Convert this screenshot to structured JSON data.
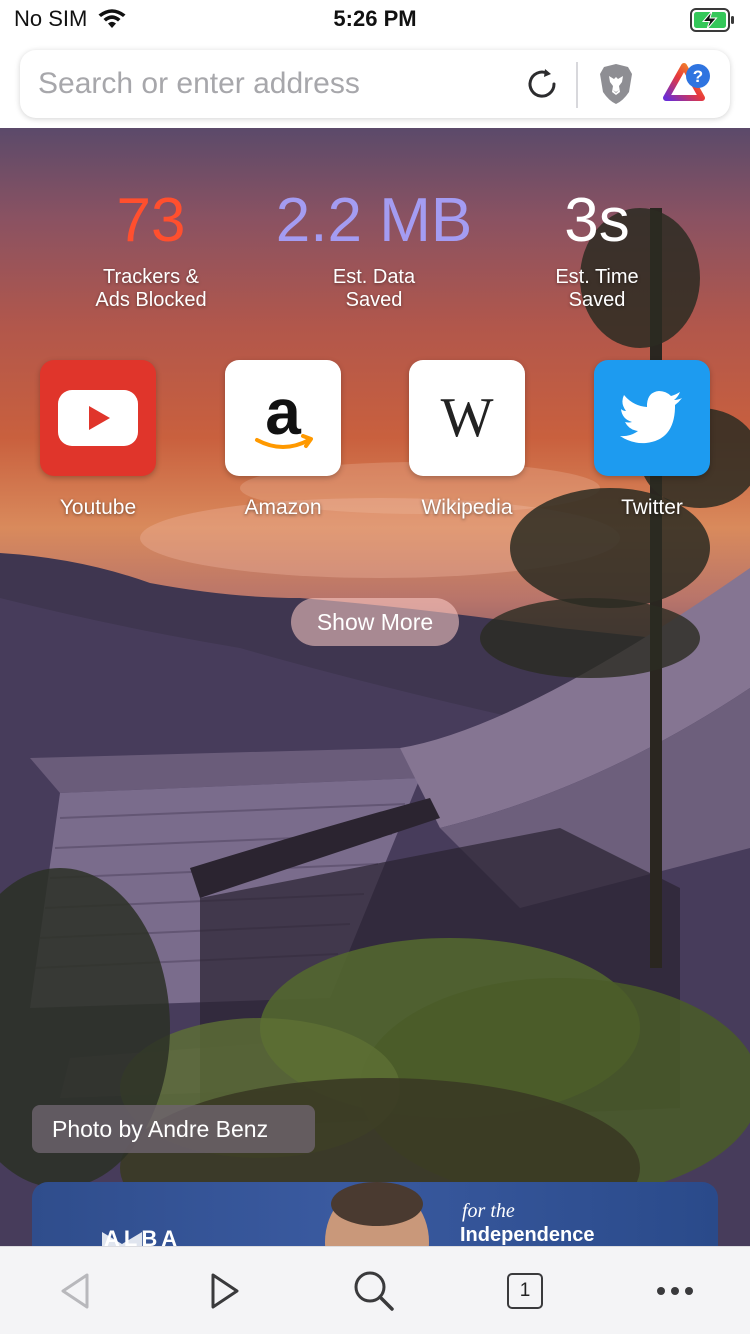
{
  "status_bar": {
    "carrier": "No SIM",
    "time": "5:26 PM"
  },
  "url_bar": {
    "placeholder": "Search or enter address",
    "value": ""
  },
  "stats": [
    {
      "value": "73",
      "label_line1": "Trackers &",
      "label_line2": "Ads Blocked",
      "color": "#ff4f2e"
    },
    {
      "value": "2.2 MB",
      "label_line1": "Est. Data",
      "label_line2": "Saved",
      "color": "#a49cf2"
    },
    {
      "value": "3s",
      "label_line1": "Est. Time",
      "label_line2": "Saved",
      "color": "#ffffff"
    }
  ],
  "favorites": [
    {
      "label": "Youtube",
      "icon": "youtube-icon",
      "color": "#e0352b"
    },
    {
      "label": "Amazon",
      "icon": "amazon-icon",
      "color": "#ffffff"
    },
    {
      "label": "Wikipedia",
      "icon": "wikipedia-icon",
      "color": "#ffffff"
    },
    {
      "label": "Twitter",
      "icon": "twitter-icon",
      "color": "#1d9bf0"
    }
  ],
  "show_more_label": "Show More",
  "photo_credit": "Photo by Andre Benz",
  "news_card": {
    "line1": "for the",
    "line2": "Independence",
    "logo": "ALBA"
  },
  "toolbar": {
    "tab_count": "1",
    "icons": [
      "back-icon",
      "forward-icon",
      "search-icon",
      "tabs-icon",
      "more-icon"
    ]
  }
}
